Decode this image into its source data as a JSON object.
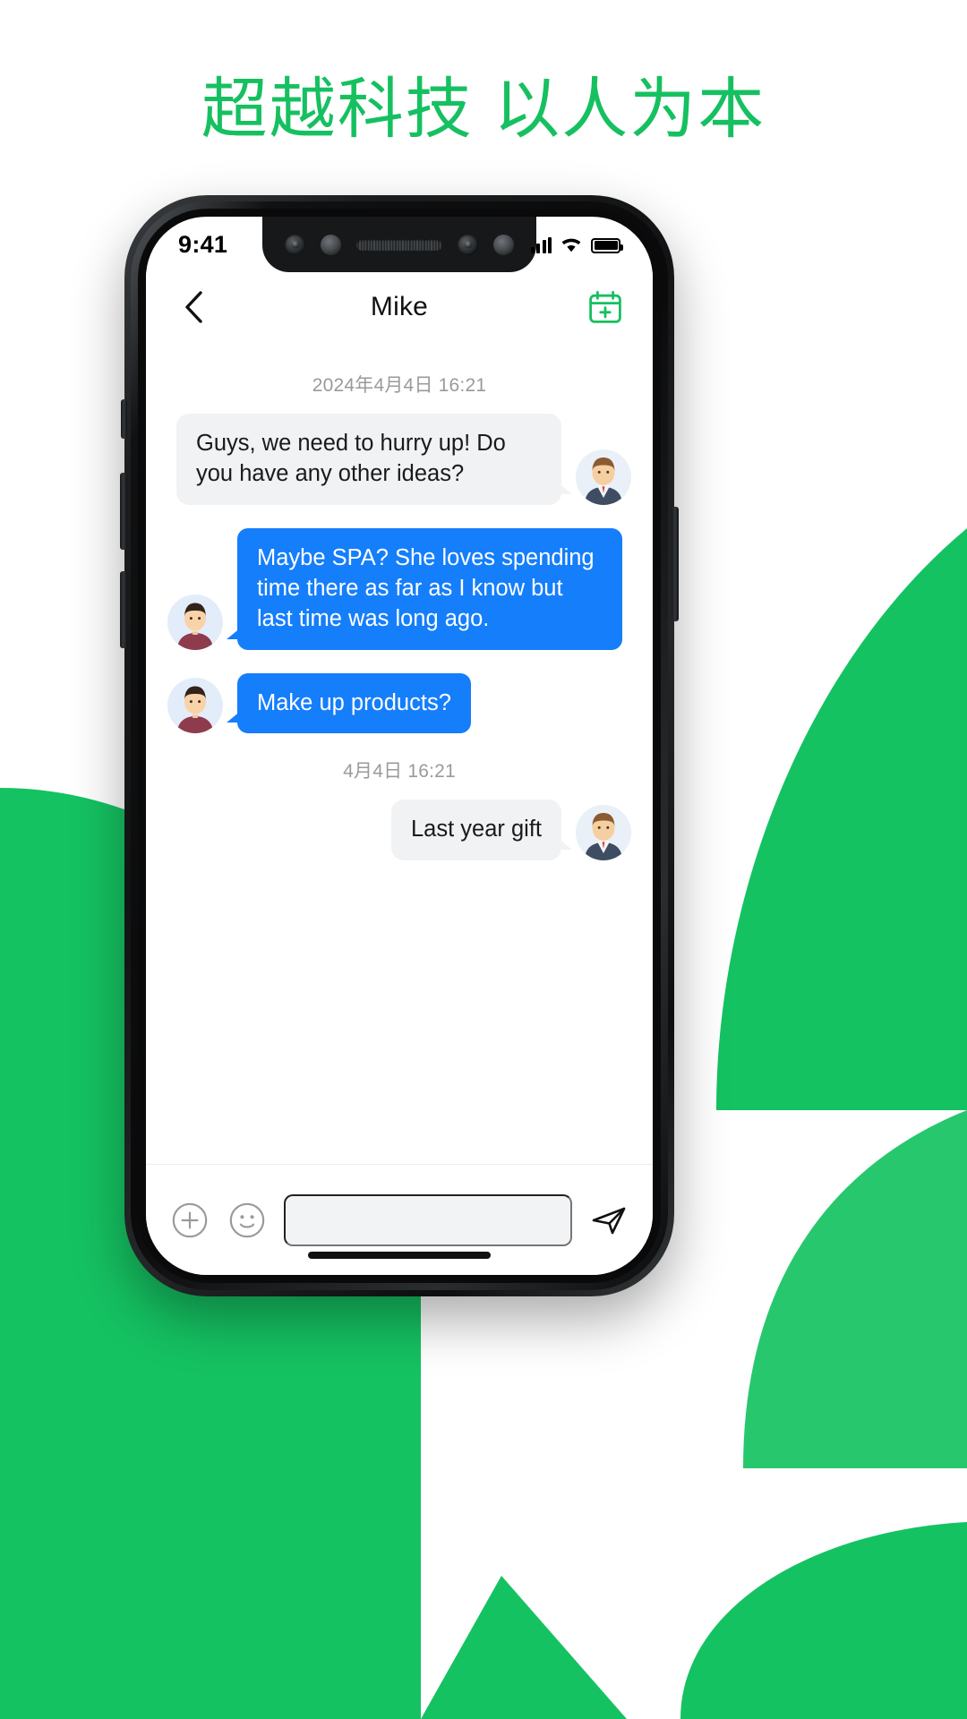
{
  "page": {
    "headline": "超越科技 以人为本",
    "brand_green": "#16C060",
    "accent_blue": "#157EFB",
    "bubble_grey": "#F1F2F4"
  },
  "status_bar": {
    "time": "9:41",
    "signal_icon": "signal-bars-icon",
    "wifi_icon": "wifi-icon",
    "battery_icon": "battery-full-icon"
  },
  "nav": {
    "back_icon": "chevron-left-icon",
    "title": "Mike",
    "action_icon": "calendar-plus-icon"
  },
  "chat": {
    "stamps": {
      "first": "2024年4月4日  16:21",
      "second": "4月4日  16:21"
    },
    "messages": [
      {
        "id": "msg-1",
        "side": "in",
        "kind": "grey",
        "text": "Guys, we need to hurry up! Do you have any other ideas?",
        "avatar": "avatar-male-suit"
      },
      {
        "id": "msg-2",
        "side": "out",
        "kind": "blue",
        "text": "Maybe SPA? She loves spending time there as far as I know but last time was long ago.",
        "avatar": "avatar-male-dark-hair"
      },
      {
        "id": "msg-3",
        "side": "out",
        "kind": "blue",
        "text": "Make up products?",
        "avatar": "avatar-male-dark-hair"
      },
      {
        "id": "msg-4",
        "side": "in",
        "kind": "grey",
        "text": "Last year gift",
        "avatar": "avatar-male-suit"
      }
    ]
  },
  "input_bar": {
    "plus_icon": "plus-circle-icon",
    "emoji_icon": "smiley-icon",
    "field_placeholder": "",
    "field_value": "",
    "send_icon": "send-paper-plane-icon"
  }
}
